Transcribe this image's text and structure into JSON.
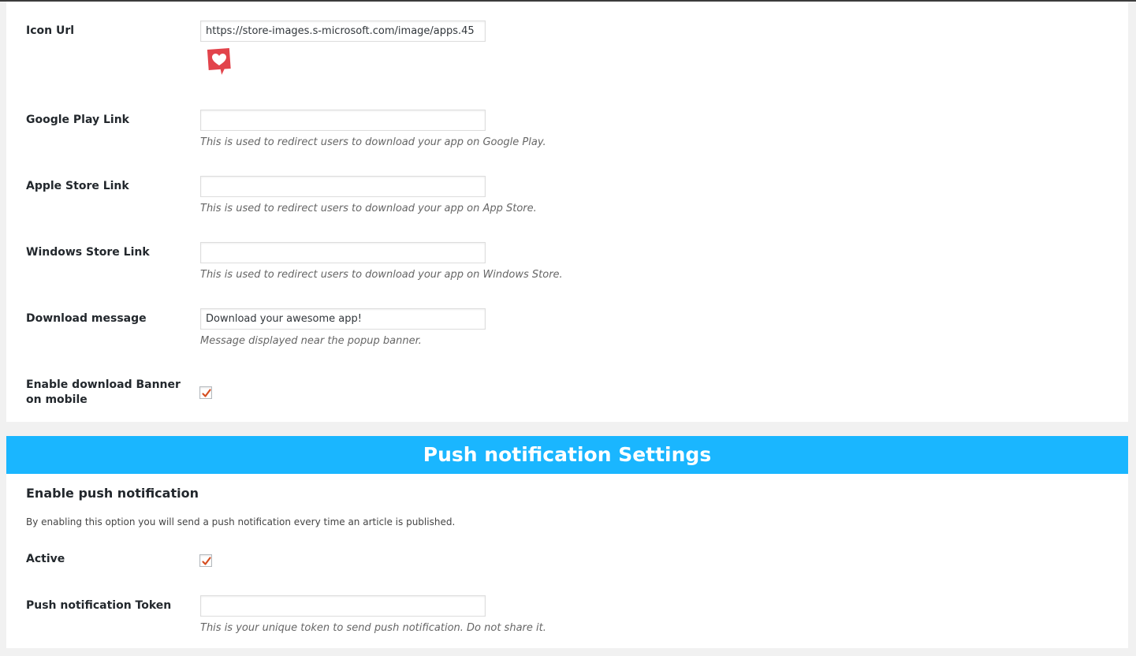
{
  "app_settings": {
    "icon_url": {
      "label": "Icon Url",
      "value": "https://store-images.s-microsoft.com/image/apps.45"
    },
    "google_play": {
      "label": "Google Play Link",
      "value": "",
      "description": "This is used to redirect users to download your app on Google Play."
    },
    "apple_store": {
      "label": "Apple Store Link",
      "value": "",
      "description": "This is used to redirect users to download your app on App Store."
    },
    "windows_store": {
      "label": "Windows Store Link",
      "value": "",
      "description": "This is used to redirect users to download your app on Windows Store."
    },
    "download_message": {
      "label": "Download message",
      "value": "Download your awesome app!",
      "description": "Message displayed near the popup banner."
    },
    "enable_banner": {
      "label": "Enable download Banner on mobile",
      "checked": true
    }
  },
  "push": {
    "banner_title": "Push notification Settings",
    "section_title": "Enable push notification",
    "section_description": "By enabling this option you will send a push notification every time an article is published.",
    "active": {
      "label": "Active",
      "checked": true
    },
    "token": {
      "label": "Push notification Token",
      "value": "",
      "description": "This is your unique token to send push notification. Do not share it."
    }
  },
  "colors": {
    "banner": "#1ab6ff",
    "check": "#d54e21",
    "heart_icon": "#e2434b"
  }
}
